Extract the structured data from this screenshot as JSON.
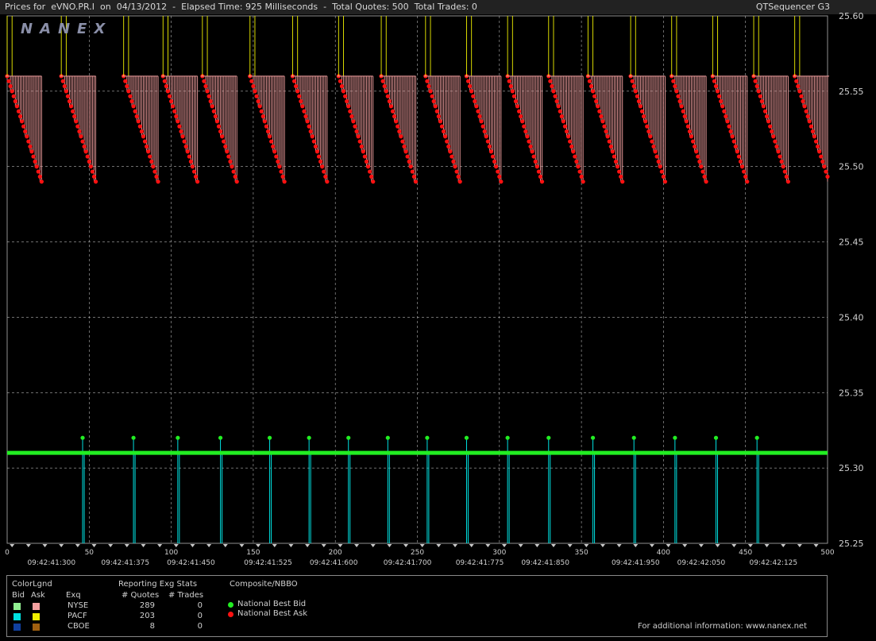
{
  "header": {
    "prefix": "Prices for",
    "symbol": "eVNO.PR.I",
    "on": "on",
    "date": "04/13/2012",
    "elapsed": "Elapsed Time: 925 Milliseconds",
    "quotes": "Total Quotes: 500",
    "trades": "Total Trades: 0",
    "app": "QTSequencer G3"
  },
  "watermark": "NANEX",
  "colors": {
    "background": "#000000",
    "grid": "#b0b0b0",
    "bid": "#22ee22",
    "ask": "#ff1111",
    "nyse_bid": "#90ee90",
    "nyse_ask": "#f4a0a0",
    "pacf_bid": "#00e0e0",
    "pacf_ask": "#f0f000",
    "cboe_bid": "#1040a0",
    "cboe_ask": "#a06010"
  },
  "chart_data": {
    "type": "line",
    "xlim": [
      0,
      500
    ],
    "ylim": [
      25.25,
      25.6
    ],
    "x_ticks": [
      "0",
      "50",
      "100",
      "150",
      "200",
      "250",
      "300",
      "350",
      "400",
      "450",
      "500"
    ],
    "time_labels": [
      {
        "x": 27,
        "label": "09:42:41:300"
      },
      {
        "x": 72,
        "label": "09:42:41:375"
      },
      {
        "x": 112,
        "label": "09:42:41:450"
      },
      {
        "x": 159,
        "label": "09:42:41:525"
      },
      {
        "x": 199,
        "label": "09:42:41:600"
      },
      {
        "x": 244,
        "label": "09:42:41:700"
      },
      {
        "x": 288,
        "label": "09:42:41:775"
      },
      {
        "x": 328,
        "label": "09:42:41:850"
      },
      {
        "x": 383,
        "label": "09:42:41:950"
      },
      {
        "x": 423,
        "label": "09:42:42:050"
      },
      {
        "x": 467,
        "label": "09:42:42:125"
      }
    ],
    "y_ticks": [
      "25.60",
      "25.55",
      "25.50",
      "25.45",
      "25.40",
      "25.35",
      "25.30",
      "25.25"
    ],
    "series": [
      {
        "name": "National Best Bid",
        "level": 25.31,
        "spike_level": 25.32,
        "spike_x": [
          46,
          77,
          104,
          130,
          160,
          184,
          208,
          232,
          256,
          280,
          305,
          330,
          357,
          382,
          407,
          432,
          457
        ]
      },
      {
        "name": "National Best Ask",
        "high": 25.56,
        "low": 25.49,
        "cycle_starts": [
          0,
          33,
          71,
          95,
          119,
          148,
          174,
          202,
          228,
          255,
          280,
          305,
          330,
          354,
          380,
          405,
          430,
          455,
          480
        ],
        "cycle_length": 22
      }
    ]
  },
  "legend": {
    "colorlgnd": "ColorLgnd",
    "bid": "Bid",
    "ask": "Ask",
    "exq": "Exq",
    "reporting": "Reporting Exg Stats",
    "quotes_hdr": "# Quotes",
    "trades_hdr": "# Trades",
    "composite": "Composite/NBBO",
    "rows": [
      {
        "exchange": "NYSE",
        "quotes": "289",
        "trades": "0"
      },
      {
        "exchange": "PACF",
        "quotes": "203",
        "trades": "0"
      },
      {
        "exchange": "CBOE",
        "quotes": "8",
        "trades": "0"
      }
    ],
    "nbbo_bid": "National Best Bid",
    "nbbo_ask": "National Best Ask",
    "more_info": "For additional information: www.nanex.net"
  }
}
